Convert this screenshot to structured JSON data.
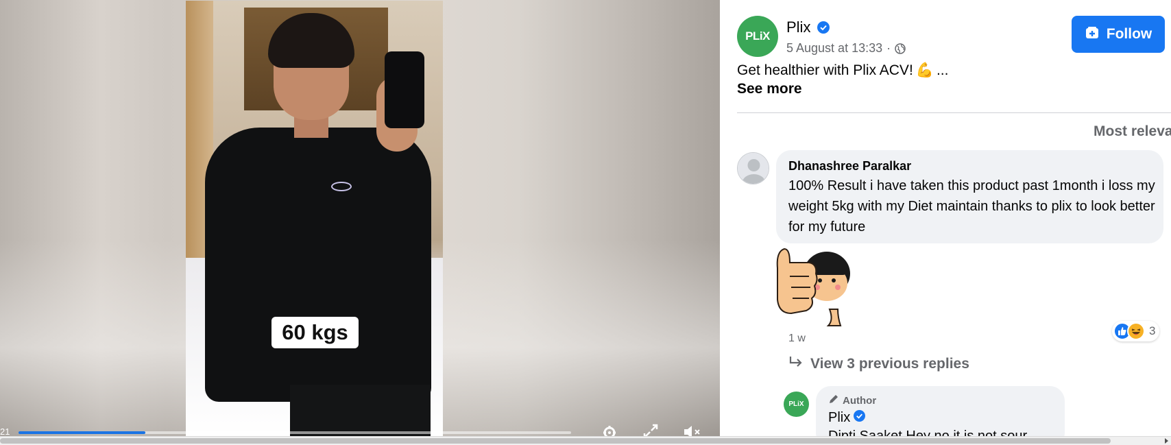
{
  "video": {
    "overlay_text": "60 kgs",
    "time_readout": "21",
    "progress": 0.23,
    "controls": [
      "gear-icon",
      "fullscreen-icon",
      "mute-icon"
    ]
  },
  "post": {
    "page_avatar_text": "PLiX",
    "page_name": "Plix",
    "verified": true,
    "timestamp": "5 August at 13:33",
    "separator": "·",
    "audience_icon": "globe-icon",
    "follow_label": "Follow",
    "text": "Get healthier with Plix ACV!",
    "text_emoji": "💪",
    "text_ellipsis": "...",
    "see_more_label": "See more"
  },
  "comments": {
    "sort_label": "Most relevant",
    "items": [
      {
        "name": "Dhanashree Paralkar",
        "text": "100% Result i have taken this product past 1month i loss my weight 5kg with my Diet maintain thanks to plix to look better for my future",
        "time": "1 w",
        "reaction_count": "3",
        "reactions": [
          "like-icon",
          "haha-icon"
        ],
        "view_replies_label": "View 3 previous replies"
      }
    ],
    "reply": {
      "avatar_text": "PLiX",
      "badge": "Author",
      "name": "Plix",
      "text": "Dipti Saaket Hey no it is not sour"
    }
  },
  "colors": {
    "accent": "#1877f2",
    "brand_green": "#3aa757",
    "bubble": "#f0f2f5",
    "secondary_text": "#65676b"
  }
}
